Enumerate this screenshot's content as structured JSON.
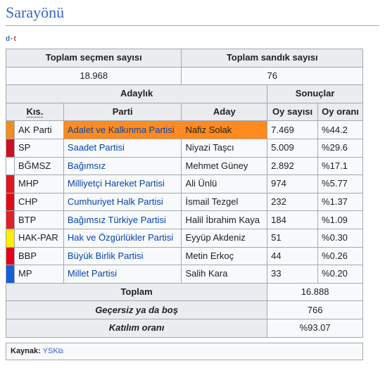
{
  "heading": "Sarayönü",
  "vte": {
    "d": "d",
    "sep": "·",
    "t": "t"
  },
  "summary": {
    "headers": [
      "Toplam seçmen sayısı",
      "Toplam sandık sayısı"
    ],
    "values": [
      "18.968",
      "76"
    ]
  },
  "groups": {
    "candidacy": "Adaylık",
    "results": "Sonuçlar"
  },
  "columns": {
    "short": "Kıs.",
    "party": "Parti",
    "candidate": "Aday",
    "votes": "Oy sayısı",
    "pct": "Oy oranı"
  },
  "rows": [
    {
      "short": "AK Parti",
      "party": "Adalet ve Kalkınma Partisi",
      "candidate": "Nafiz Solak",
      "votes": "7.469",
      "pct": "%44.2",
      "color": "#f18e1d",
      "winner": true
    },
    {
      "short": "SP",
      "party": "Saadet Partisi",
      "candidate": "Niyazi Taşcı",
      "votes": "5.009",
      "pct": "%29.6",
      "color": "#cc1020",
      "winner": false
    },
    {
      "short": "BĞMSZ",
      "party": "Bağımsız",
      "candidate": "Mehmet Güney",
      "votes": "2.892",
      "pct": "%17.1",
      "color": "#ffffff",
      "winner": false
    },
    {
      "short": "MHP",
      "party": "Milliyetçi Hareket Partisi",
      "candidate": "Ali Ünlü",
      "votes": "974",
      "pct": "%5.77",
      "color": "#e1151d",
      "winner": false
    },
    {
      "short": "CHP",
      "party": "Cumhuriyet Halk Partisi",
      "candidate": "İsmail Tezgel",
      "votes": "232",
      "pct": "%1.37",
      "color": "#e30a17",
      "winner": false
    },
    {
      "short": "BTP",
      "party": "Bağımsız Türkiye Partisi",
      "candidate": "Halil İbrahim Kaya",
      "votes": "184",
      "pct": "%1.09",
      "color": "#e01f26",
      "winner": false
    },
    {
      "short": "HAK-PAR",
      "party": "Hak ve Özgürlükler Partisi",
      "candidate": "Eyyüp Akdeniz",
      "votes": "51",
      "pct": "%0.30",
      "color": "#ffee00",
      "winner": false
    },
    {
      "short": "BBP",
      "party": "Büyük Birlik Partisi",
      "candidate": "Metin Erkoç",
      "votes": "44",
      "pct": "%0.26",
      "color": "#e3001b",
      "winner": false
    },
    {
      "short": "MP",
      "party": "Millet Partisi",
      "candidate": "Salih Kara",
      "votes": "33",
      "pct": "%0.20",
      "color": "#1560d4",
      "winner": false
    }
  ],
  "totals": [
    {
      "label": "Toplam",
      "value": "16.888"
    },
    {
      "label": "Geçersiz ya da boş",
      "value": "766"
    },
    {
      "label": "Katılım oranı",
      "value": "%93.07"
    }
  ],
  "source": {
    "label": "Kaynak:",
    "link": "YSK",
    "ext_icon": "external-link-icon"
  }
}
